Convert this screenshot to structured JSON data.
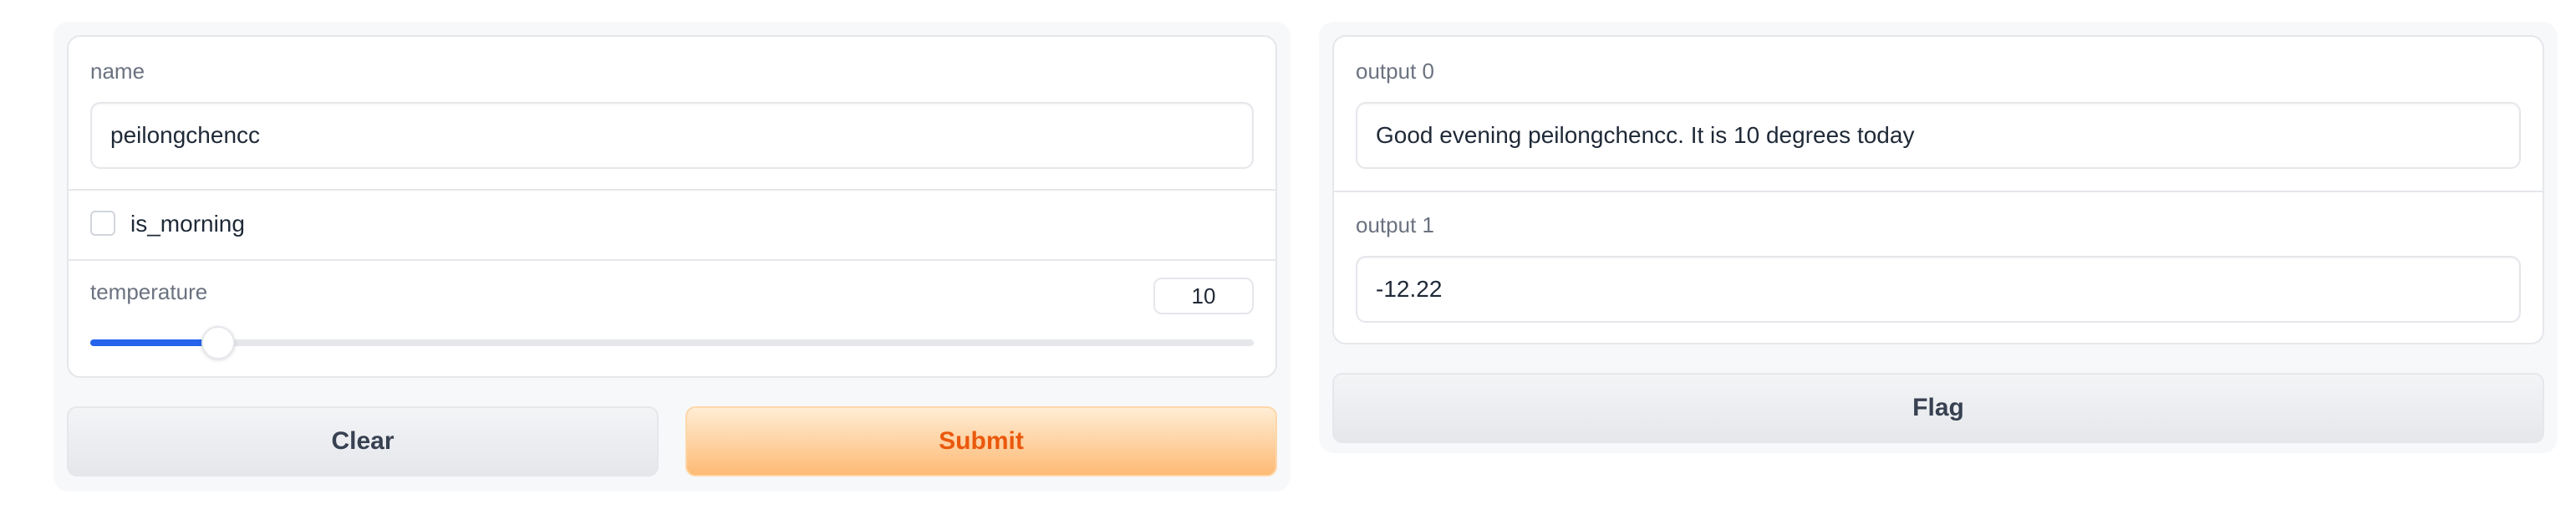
{
  "inputs": {
    "name": {
      "label": "name",
      "value": "peilongchencc"
    },
    "is_morning": {
      "label": "is_morning",
      "checked": false
    },
    "temperature": {
      "label": "temperature",
      "value": "10",
      "min": 0,
      "max": 100,
      "fraction": 0.11
    }
  },
  "actions": {
    "clear_label": "Clear",
    "submit_label": "Submit",
    "flag_label": "Flag"
  },
  "outputs": {
    "output0": {
      "label": "output 0",
      "value": "Good evening peilongchencc. It is 10 degrees today"
    },
    "output1": {
      "label": "output 1",
      "value": "-12.22"
    }
  },
  "colors": {
    "accent": "#2563eb",
    "primary_text": "#ea580c",
    "primary_bg": "#fdba74"
  }
}
